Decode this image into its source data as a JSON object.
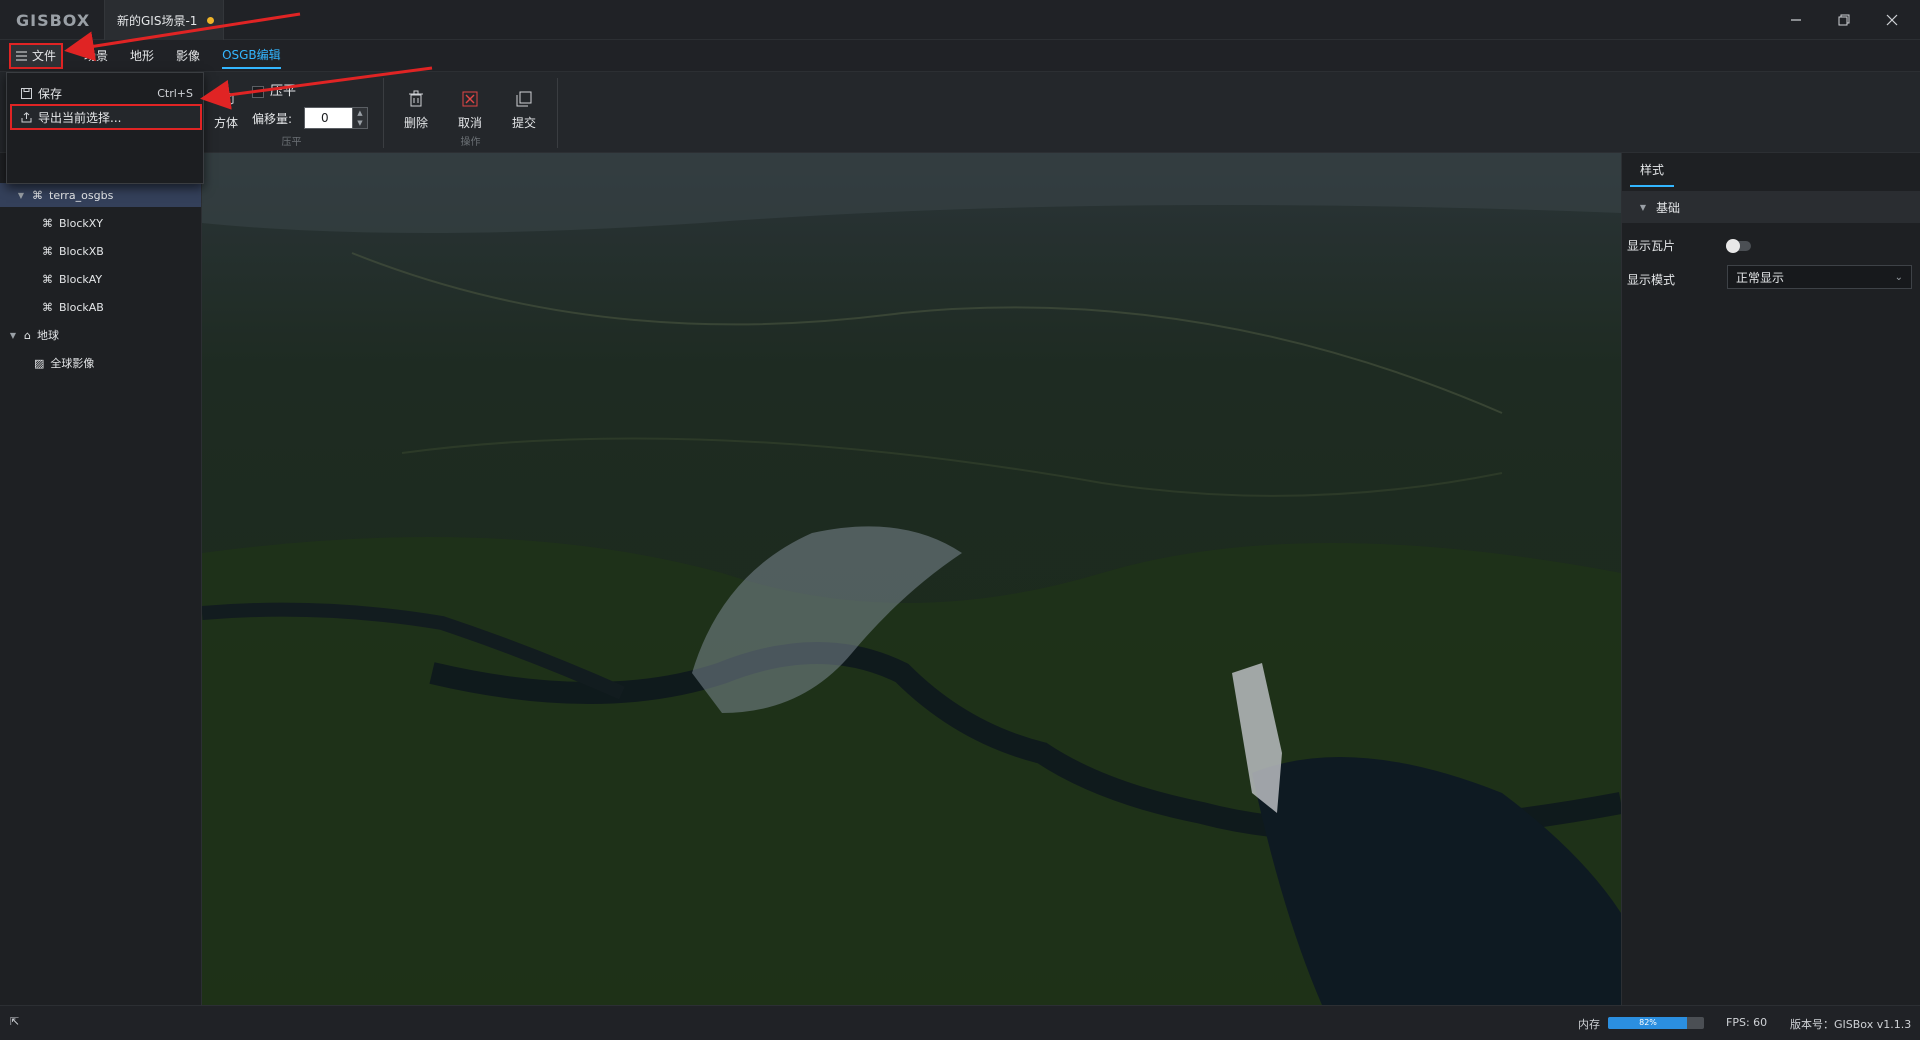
{
  "app": {
    "logo": "GISBOX",
    "document_tab": "新的GIS场景-1"
  },
  "menubar": {
    "file_label": "文件",
    "items": [
      "场景",
      "地形",
      "影像",
      "OSGB编辑"
    ],
    "active_index": 3
  },
  "file_dropdown": {
    "save_label": "保存",
    "save_shortcut": "Ctrl+S",
    "export_label": "导出当前选择..."
  },
  "toolbar": {
    "partial_label": "方体",
    "flatten_label": "压平",
    "offset_label": "偏移量:",
    "offset_value": "0",
    "flatten_group": "压平",
    "delete_label": "删除",
    "cancel_label": "取消",
    "submit_label": "提交",
    "ops_group": "操作"
  },
  "tree": {
    "items": [
      {
        "label": "terra_osgbs",
        "level": 1,
        "expanded": true,
        "selected": true,
        "icon": "osgb-icon"
      },
      {
        "label": "BlockXY",
        "level": 2,
        "icon": "osgb-icon"
      },
      {
        "label": "BlockXB",
        "level": 2,
        "icon": "osgb-icon"
      },
      {
        "label": "BlockAY",
        "level": 2,
        "icon": "osgb-icon"
      },
      {
        "label": "BlockAB",
        "level": 2,
        "icon": "osgb-icon"
      },
      {
        "label": "地球",
        "level": 0,
        "expanded": true,
        "icon": "globe-icon"
      },
      {
        "label": "全球影像",
        "level": 1,
        "icon": "image-layer-icon"
      }
    ]
  },
  "properties": {
    "tab": "样式",
    "section": "基础",
    "show_tiles_label": "显示瓦片",
    "show_tiles_on": false,
    "display_mode_label": "显示模式",
    "display_mode_value": "正常显示"
  },
  "status": {
    "memory_label": "内存",
    "memory_value": "82%",
    "memory_fraction": 0.82,
    "fps": "FPS: 60",
    "version": "版本号：GISBox v1.1.3"
  },
  "colors": {
    "accent": "#33b6ff",
    "annotation": "#e02424",
    "unsaved": "#f0b429"
  }
}
